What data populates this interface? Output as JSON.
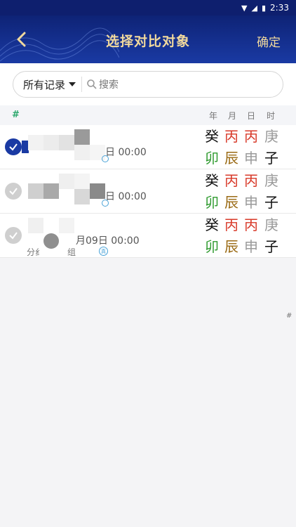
{
  "status": {
    "time": "2:33"
  },
  "header": {
    "title": "选择对比对象",
    "confirm": "确定"
  },
  "search": {
    "filter_label": "所有记录",
    "placeholder": "搜索"
  },
  "columns": {
    "hash": "#",
    "year": "年",
    "month": "月",
    "day": "日",
    "hour": "时"
  },
  "rows": [
    {
      "selected": true,
      "date": "日 00:00",
      "pillars": [
        "癸",
        "丙",
        "丙",
        "庚",
        "卯",
        "辰",
        "申",
        "子"
      ]
    },
    {
      "selected": false,
      "date": "日 00:00",
      "pillars": [
        "癸",
        "丙",
        "丙",
        "庚",
        "卯",
        "辰",
        "申",
        "子"
      ]
    },
    {
      "selected": false,
      "date": "月09日 00:00",
      "group_a": "分纟",
      "group_b": "组",
      "pillars": [
        "癸",
        "丙",
        "丙",
        "庚",
        "卯",
        "辰",
        "申",
        "子"
      ]
    }
  ],
  "side_index": "#",
  "colors": {
    "accent": "#1a3aa3",
    "gold": "#f1d99d",
    "red": "#d83a2a",
    "green": "#2e9a2e",
    "brown": "#9a6a14",
    "gray": "#9a9a9a",
    "black": "#111111"
  }
}
